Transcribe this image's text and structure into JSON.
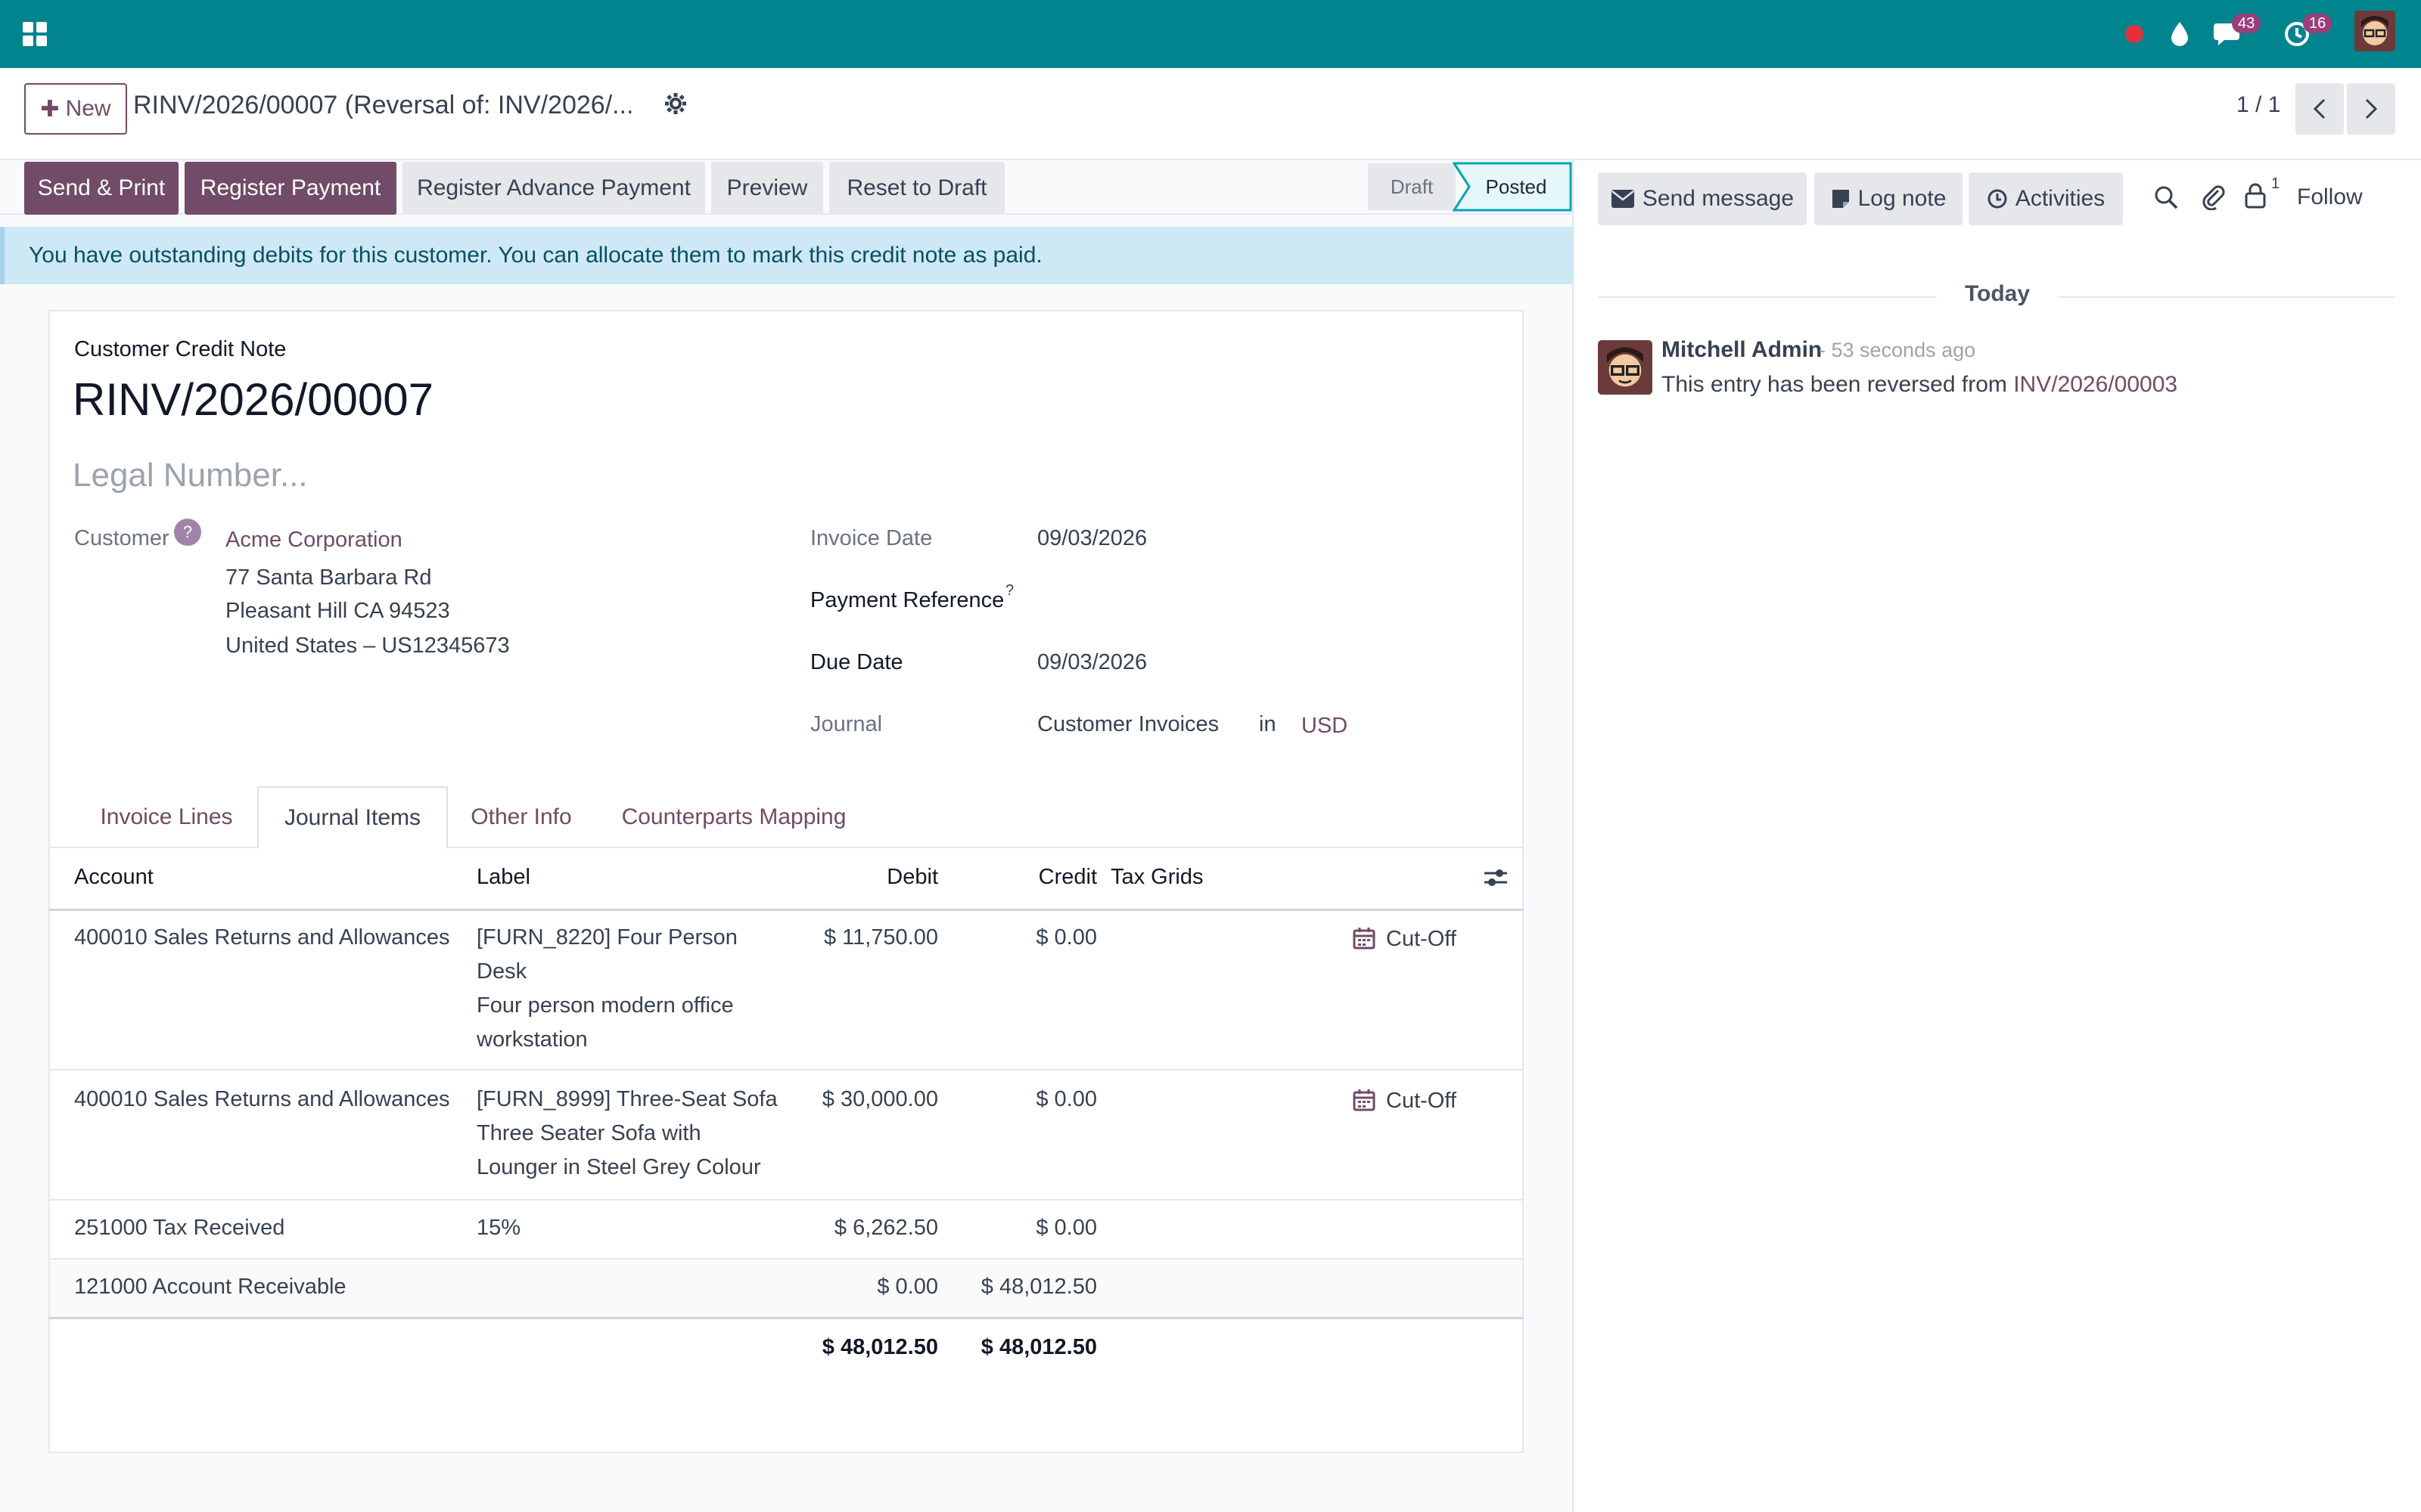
{
  "topbar": {
    "badges": {
      "messages": "43",
      "activities": "16"
    }
  },
  "control": {
    "new_label": "New",
    "record_title": "RINV/2026/00007 (Reversal of: INV/2026/...",
    "pager": "1 / 1"
  },
  "actions": {
    "send_print": "Send & Print",
    "register_payment": "Register Payment",
    "register_advance": "Register Advance Payment",
    "preview": "Preview",
    "reset_draft": "Reset to Draft"
  },
  "status": {
    "draft": "Draft",
    "posted": "Posted",
    "current": "Posted"
  },
  "alert": {
    "part1": "You have ",
    "link": "outstanding debits",
    "part2": " for this customer. You can allocate them to mark this credit note as paid."
  },
  "form": {
    "doc_type": "Customer Credit Note",
    "number": "RINV/2026/00007",
    "legal_placeholder": "Legal Number...",
    "customer_label": "Customer",
    "help_mark": "?",
    "customer_name": "Acme Corporation",
    "address_line1": "77 Santa Barbara Rd",
    "address_line2": "Pleasant Hill CA 94523",
    "address_line3": "United States – US12345673",
    "invoice_date_label": "Invoice Date",
    "invoice_date": "09/03/2026",
    "payment_ref_label": "Payment Reference",
    "payment_ref_help": "?",
    "due_date_label": "Due Date",
    "due_date": "09/03/2026",
    "journal_label": "Journal",
    "journal_value": "Customer Invoices",
    "journal_in": "in",
    "currency": "USD"
  },
  "tabs": [
    "Invoice Lines",
    "Journal Items",
    "Other Info",
    "Counterparts Mapping"
  ],
  "table": {
    "headers": {
      "account": "Account",
      "label": "Label",
      "debit": "Debit",
      "credit": "Credit",
      "tax_grids": "Tax Grids"
    },
    "rows": [
      {
        "account": "400010 Sales Returns and Allowances",
        "label": [
          "[FURN_8220] Four Person",
          "Desk",
          "Four person modern office",
          "workstation"
        ],
        "debit": "$ 11,750.00",
        "credit": "$ 0.00",
        "cutoff": "Cut-Off"
      },
      {
        "account": "400010 Sales Returns and Allowances",
        "label": [
          "[FURN_8999] Three-Seat Sofa",
          "Three Seater Sofa with",
          "Lounger in Steel Grey Colour"
        ],
        "debit": "$ 30,000.00",
        "credit": "$ 0.00",
        "cutoff": "Cut-Off"
      },
      {
        "account": "251000 Tax Received",
        "label": [
          "15%"
        ],
        "debit": "$ 6,262.50",
        "credit": "$ 0.00"
      },
      {
        "account": "121000 Account Receivable",
        "label": [],
        "debit": "$ 0.00",
        "credit": "$ 48,012.50"
      }
    ],
    "totals": {
      "debit": "$ 48,012.50",
      "credit": "$ 48,012.50"
    }
  },
  "chatter": {
    "send_message": "Send message",
    "log_note": "Log note",
    "activities": "Activities",
    "follower_count": "1",
    "follow": "Follow",
    "date_separator": "Today",
    "message": {
      "author": "Mitchell Admin",
      "time": "- 53 seconds ago",
      "body": "This entry has been reversed from ",
      "link": "INV/2026/00003"
    }
  }
}
